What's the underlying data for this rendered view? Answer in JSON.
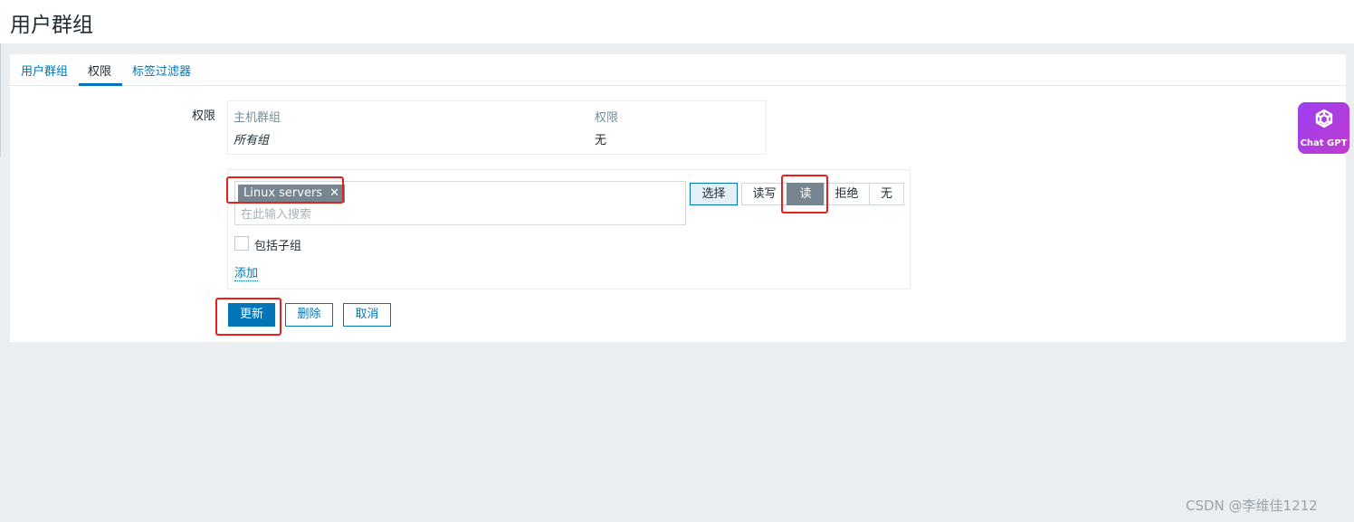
{
  "page": {
    "title": "用户群组"
  },
  "tabs": [
    {
      "label": "用户群组",
      "active": false
    },
    {
      "label": "权限",
      "active": true
    },
    {
      "label": "标签过滤器",
      "active": false
    }
  ],
  "permissions": {
    "label": "权限",
    "table": {
      "headers": [
        "主机群组",
        "权限"
      ],
      "rows": [
        {
          "group": "所有组",
          "permission": "无"
        }
      ]
    }
  },
  "add_panel": {
    "selected_chips": [
      "Linux servers"
    ],
    "search_placeholder": "在此输入搜索",
    "select_button": "选择",
    "permission_options": [
      {
        "label": "读写",
        "active": false
      },
      {
        "label": "读",
        "active": true
      },
      {
        "label": "拒绝",
        "active": false
      },
      {
        "label": "无",
        "active": false
      }
    ],
    "include_subgroups_label": "包括子组",
    "include_subgroups_checked": false,
    "add_link": "添加"
  },
  "actions": {
    "update": "更新",
    "delete": "删除",
    "cancel": "取消"
  },
  "badge": {
    "text": "Chat GPT",
    "icon": "chatgpt-logo-icon"
  },
  "watermark": "CSDN @李维佳1212",
  "colors": {
    "accent": "#0275b8",
    "active_toggle": "#76858f",
    "highlight": "#e5201d",
    "background": "#ebeef0"
  }
}
